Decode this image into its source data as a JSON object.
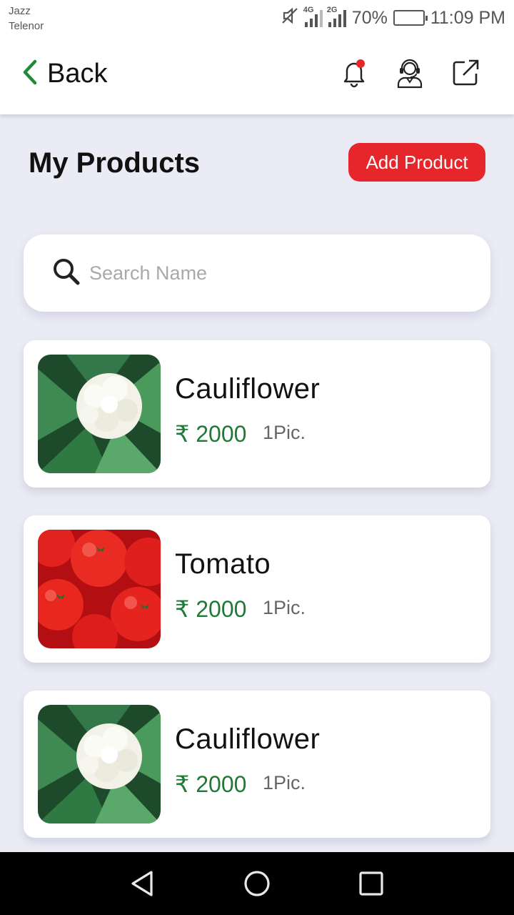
{
  "status_bar": {
    "carrier_1": "Jazz",
    "carrier_2": "Telenor",
    "network_1": "4G",
    "network_2": "2G",
    "battery_percent": "70%",
    "battery_level": 0.7,
    "time": "11:09 PM",
    "icons": [
      "mute-icon",
      "signal-icon",
      "signal-icon",
      "battery-icon"
    ]
  },
  "app_bar": {
    "back_label": "Back",
    "icons": [
      "chevron-left-icon",
      "bell-icon",
      "support-agent-icon",
      "external-link-icon"
    ],
    "colors": {
      "back_chevron": "#1f8a3c",
      "notification_dot": "#e7262b"
    }
  },
  "header": {
    "title": "My Products",
    "add_button_label": "Add Product"
  },
  "search": {
    "placeholder": "Search Name",
    "value": "",
    "icon": "search-icon"
  },
  "products": [
    {
      "name": "Cauliflower",
      "price": "₹ 2000",
      "unit": "1Pic.",
      "image": "cauliflower"
    },
    {
      "name": "Tomato",
      "price": "₹ 2000",
      "unit": "1Pic.",
      "image": "tomato"
    },
    {
      "name": "Cauliflower",
      "price": "₹ 2000",
      "unit": "1Pic.",
      "image": "cauliflower"
    }
  ],
  "nav_bar": {
    "icons": [
      "back-triangle-icon",
      "home-circle-icon",
      "recents-square-icon"
    ]
  },
  "colors": {
    "accent_red": "#e7262b",
    "price_green": "#1f7a36",
    "background": "#eaebf5"
  }
}
